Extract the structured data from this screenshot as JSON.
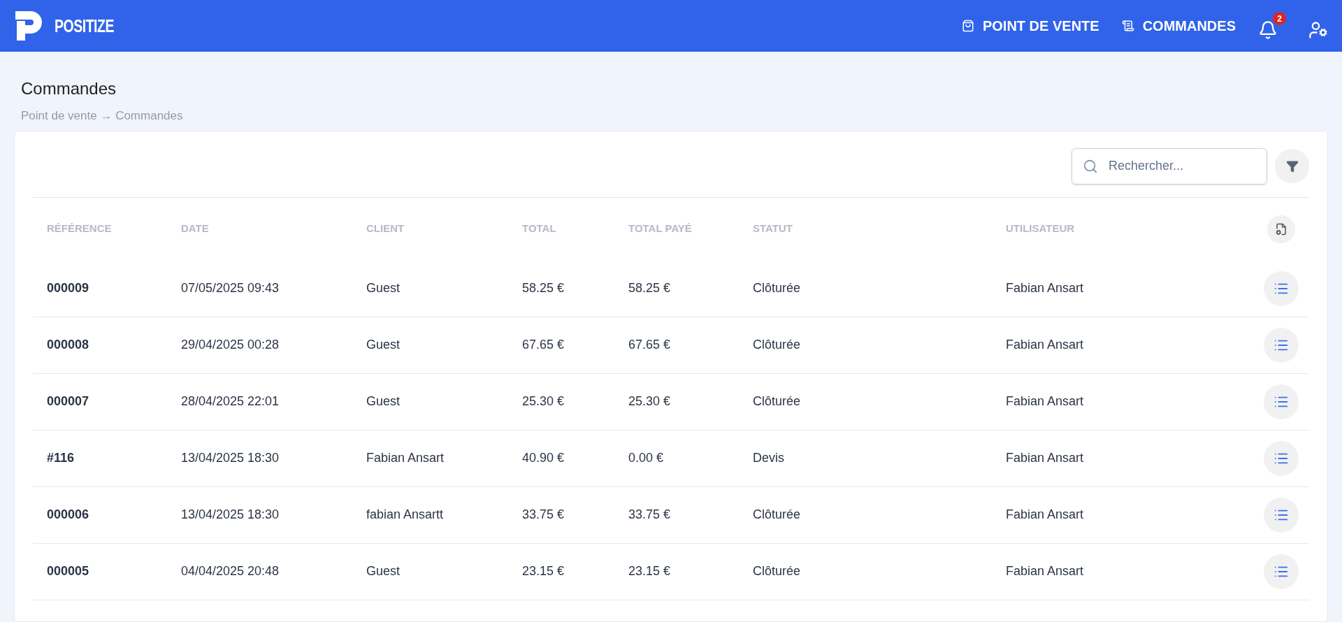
{
  "brand": "POSITIZE",
  "nav": [
    {
      "kind": "shop",
      "label": "POINT DE VENTE"
    },
    {
      "kind": "orders",
      "label": "COMMANDES"
    }
  ],
  "notifications": {
    "count": "2"
  },
  "page": {
    "title": "Commandes",
    "breadcrumb": "Point de vente → Commandes"
  },
  "search": {
    "placeholder": "Rechercher..."
  },
  "table": {
    "columns": [
      "RÉFÉRENCE",
      "DATE",
      "CLIENT",
      "TOTAL",
      "TOTAL PAYÉ",
      "STATUT",
      "UTILISATEUR"
    ],
    "rows": [
      {
        "reference": "000009",
        "date": "07/05/2025 09:43",
        "client": "Guest",
        "total": "58.25 €",
        "total_paid": "58.25 €",
        "status": "Clôturée",
        "user": "Fabian Ansart"
      },
      {
        "reference": "000008",
        "date": "29/04/2025 00:28",
        "client": "Guest",
        "total": "67.65 €",
        "total_paid": "67.65 €",
        "status": "Clôturée",
        "user": "Fabian Ansart"
      },
      {
        "reference": "000007",
        "date": "28/04/2025 22:01",
        "client": "Guest",
        "total": "25.30 €",
        "total_paid": "25.30 €",
        "status": "Clôturée",
        "user": "Fabian Ansart"
      },
      {
        "reference": "#116",
        "date": "13/04/2025 18:30",
        "client": "Fabian Ansart",
        "total": "40.90 €",
        "total_paid": "0.00 €",
        "status": "Devis",
        "user": "Fabian Ansart"
      },
      {
        "reference": "000006",
        "date": "13/04/2025 18:30",
        "client": "fabian Ansartt",
        "total": "33.75 €",
        "total_paid": "33.75 €",
        "status": "Clôturée",
        "user": "Fabian Ansart"
      },
      {
        "reference": "000005",
        "date": "04/04/2025 20:48",
        "client": "Guest",
        "total": "23.15 €",
        "total_paid": "23.15 €",
        "status": "Clôturée",
        "user": "Fabian Ansart"
      }
    ]
  }
}
